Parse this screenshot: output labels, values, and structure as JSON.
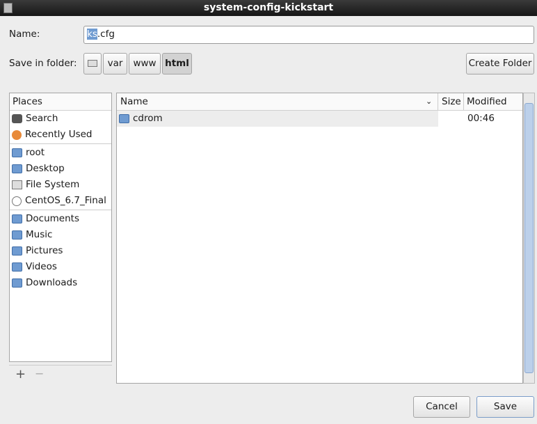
{
  "window": {
    "title": "system-config-kickstart"
  },
  "name": {
    "label": "Name:",
    "value_selected": "ks",
    "value_rest": ".cfg"
  },
  "folder": {
    "label": "Save in folder:",
    "crumbs": [
      "var",
      "www",
      "html"
    ],
    "create_folder": "Create Folder"
  },
  "places": {
    "header": "Places",
    "groups": [
      [
        "Search",
        "Recently Used"
      ],
      [
        "root",
        "Desktop",
        "File System",
        "CentOS_6.7_Final"
      ],
      [
        "Documents",
        "Music",
        "Pictures",
        "Videos",
        "Downloads"
      ]
    ]
  },
  "files": {
    "columns": {
      "name": "Name",
      "size": "Size",
      "modified": "Modified"
    },
    "rows": [
      {
        "name": "cdrom",
        "size": "",
        "modified": "00:46"
      }
    ]
  },
  "buttons": {
    "add": "+",
    "remove": "−",
    "cancel": "Cancel",
    "save": "Save"
  }
}
